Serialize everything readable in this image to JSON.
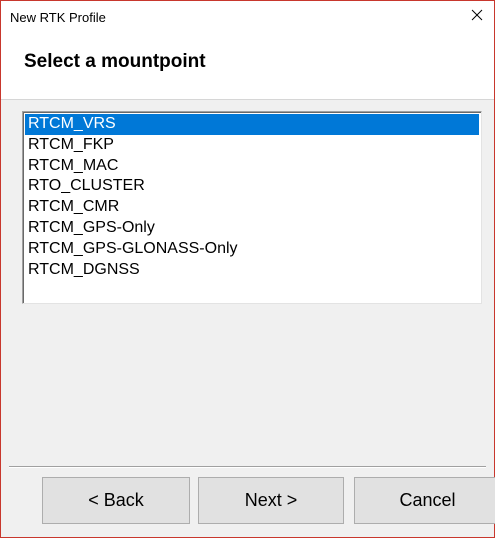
{
  "window": {
    "title": "New RTK Profile",
    "close_icon": "close-icon"
  },
  "header": {
    "title": "Select a mountpoint"
  },
  "mountpoints": {
    "selected_index": 0,
    "items": [
      "RTCM_VRS",
      "RTCM_FKP",
      "RTCM_MAC",
      "RTO_CLUSTER",
      "RTCM_CMR",
      "RTCM_GPS-Only",
      "RTCM_GPS-GLONASS-Only",
      "RTCM_DGNSS"
    ]
  },
  "buttons": {
    "back": "< Back",
    "next": "Next >",
    "cancel": "Cancel"
  },
  "colors": {
    "selection": "#0078d7",
    "window_border": "#c8372d",
    "dialog_background": "#f0f0f0"
  }
}
